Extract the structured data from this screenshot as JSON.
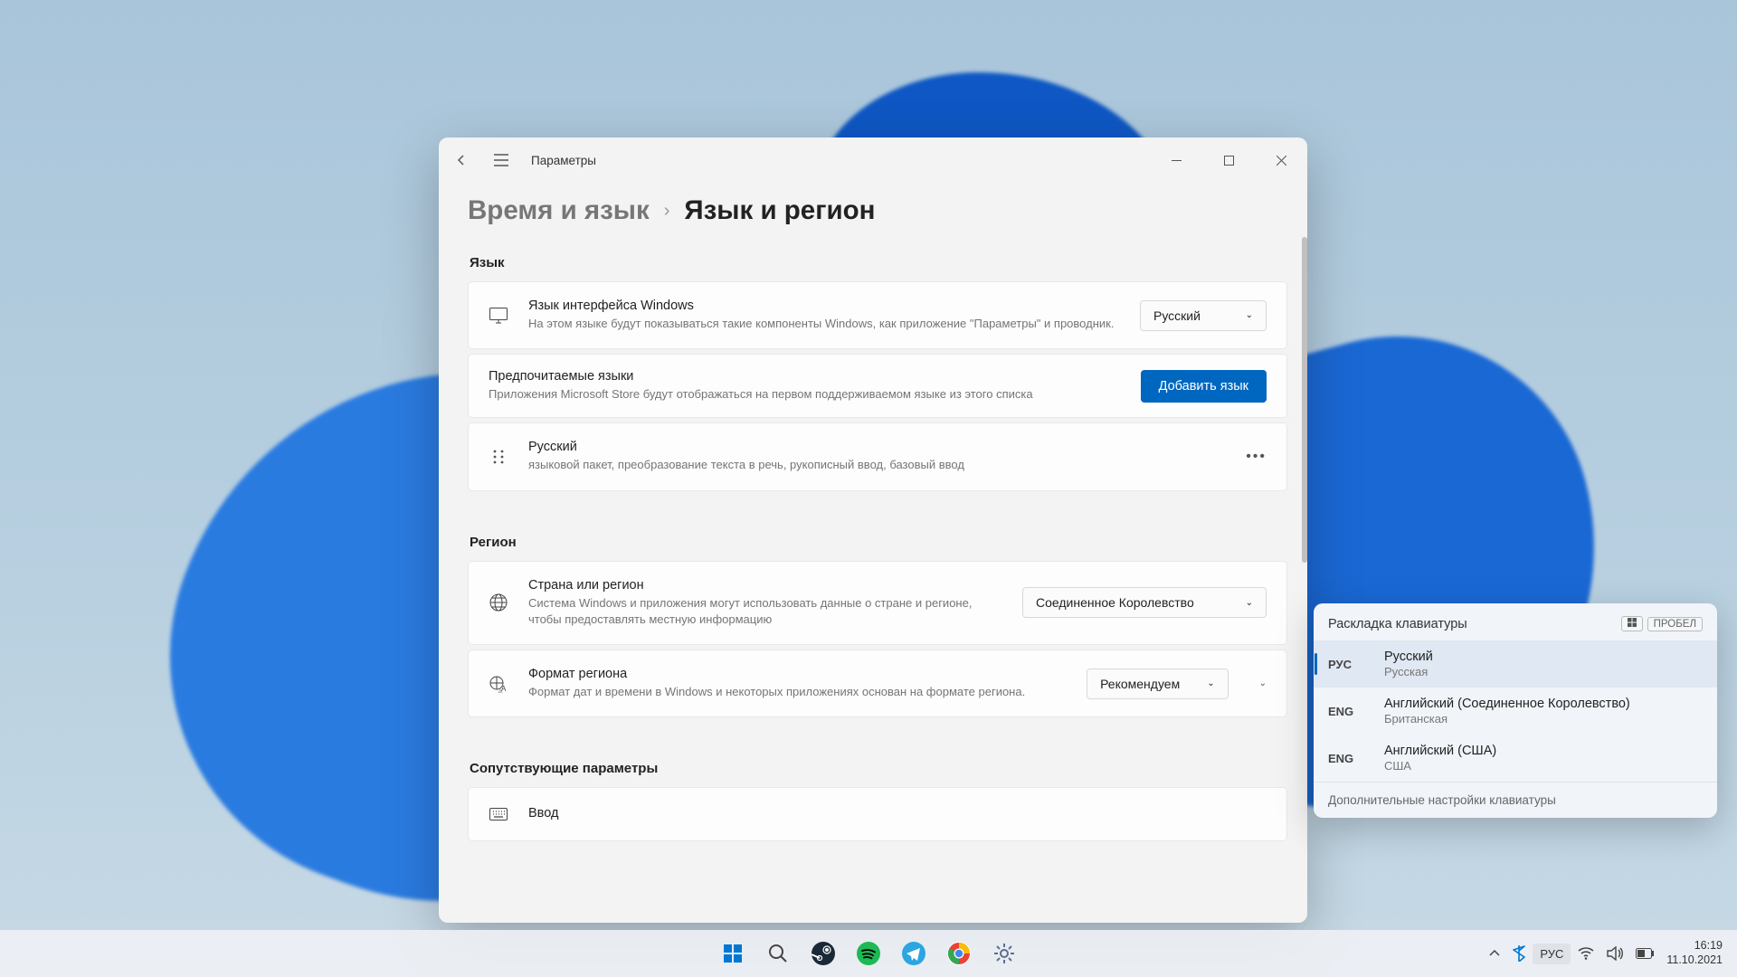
{
  "window": {
    "title": "Параметры",
    "breadcrumb_parent": "Время и язык",
    "breadcrumb_current": "Язык и регион"
  },
  "sections": {
    "language_heading": "Язык",
    "region_heading": "Регион",
    "related_heading": "Сопутствующие параметры"
  },
  "cards": {
    "display_lang": {
      "title": "Язык интерфейса Windows",
      "desc": "На этом языке будут показываться такие компоненты Windows, как приложение \"Параметры\" и проводник.",
      "value": "Русский"
    },
    "preferred": {
      "title": "Предпочитаемые языки",
      "desc": "Приложения Microsoft Store будут отображаться на первом поддерживаемом языке из этого списка",
      "button": "Добавить язык"
    },
    "lang_item": {
      "name": "Русский",
      "features": "языковой пакет, преобразование текста в речь, рукописный ввод, базовый ввод"
    },
    "country": {
      "title": "Страна или регион",
      "desc": "Система Windows и приложения могут использовать данные о стране и регионе, чтобы предоставлять местную информацию",
      "value": "Соединенное Королевство"
    },
    "regional_format": {
      "title": "Формат региона",
      "desc": "Формат дат и времени в Windows и некоторых приложениях основан на формате региона.",
      "value": "Рекомендуем"
    },
    "input": {
      "title": "Ввод"
    }
  },
  "kbd_popup": {
    "title": "Раскладка клавиатуры",
    "shortcut_key2": "ПРОБЕЛ",
    "items": [
      {
        "code": "РУС",
        "lang": "Русский",
        "sub": "Русская",
        "selected": true
      },
      {
        "code": "ENG",
        "lang": "Английский (Соединенное Королевство)",
        "sub": "Британская",
        "selected": false
      },
      {
        "code": "ENG",
        "lang": "Английский (США)",
        "sub": "США",
        "selected": false
      }
    ],
    "footer": "Дополнительные настройки клавиатуры"
  },
  "taskbar": {
    "lang": "РУС",
    "time": "16:19",
    "date": "11.10.2021"
  }
}
